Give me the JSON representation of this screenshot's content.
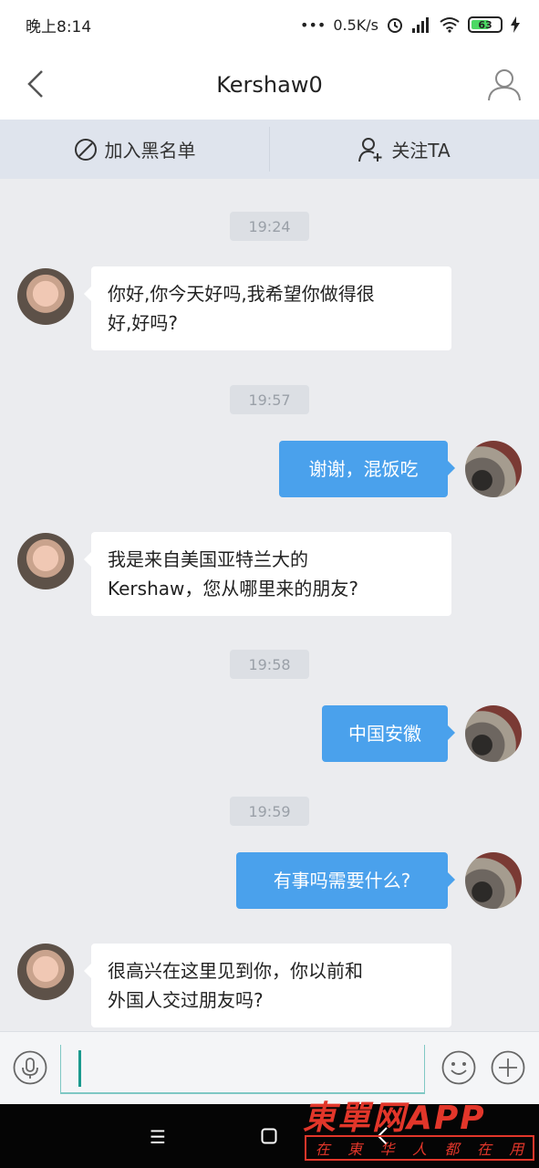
{
  "status_bar": {
    "time": "晚上8:14",
    "network_speed": "0.5K/s",
    "battery_level": "63",
    "battery_color": "#4cd964"
  },
  "nav": {
    "title": "Kershaw0",
    "back_icon": "chevron-left-icon",
    "profile_icon": "user-icon"
  },
  "actions": {
    "blacklist_label": "加入黑名单",
    "follow_label": "关注TA"
  },
  "messages": [
    {
      "type": "time",
      "text": "19:24"
    },
    {
      "type": "in",
      "text_lines": [
        "你好,你今天好吗,我希望你做得很",
        "好,好吗?"
      ]
    },
    {
      "type": "time",
      "text": "19:57"
    },
    {
      "type": "out",
      "text": "谢谢，混饭吃"
    },
    {
      "type": "in",
      "text_lines": [
        "我是来自美国亚特兰大的",
        "Kershaw，您从哪里来的朋友?"
      ]
    },
    {
      "type": "time",
      "text": "19:58"
    },
    {
      "type": "out",
      "text": "中国安徽"
    },
    {
      "type": "time",
      "text": "19:59"
    },
    {
      "type": "out",
      "text": "有事吗需要什么?"
    },
    {
      "type": "in",
      "text_lines": [
        "很高兴在这里见到你，你以前和",
        "外国人交过朋友吗?"
      ]
    }
  ],
  "input": {
    "value": "",
    "mic_icon": "microphone-icon",
    "emoji_icon": "smiley-icon",
    "plus_icon": "plus-circle-icon"
  },
  "watermark": {
    "title": "東單网APP",
    "tagline": [
      "在",
      "東",
      "华",
      "人",
      "都",
      "在",
      "用"
    ]
  },
  "colors": {
    "accent": "#4aa1ec",
    "background": "#ebecef",
    "action_bar": "#dfe4ed"
  }
}
